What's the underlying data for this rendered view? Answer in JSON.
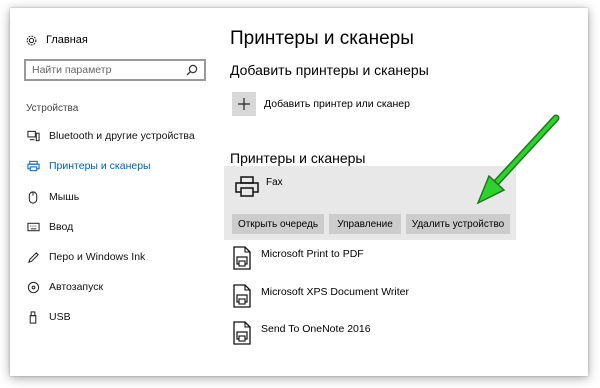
{
  "sidebar": {
    "home_label": "Главная",
    "search_placeholder": "Найти параметр",
    "section_label": "Устройства",
    "items": [
      {
        "label": "Bluetooth и другие устройства",
        "icon": "bluetooth-devices-icon"
      },
      {
        "label": "Принтеры и сканеры",
        "icon": "printer-icon",
        "active": true
      },
      {
        "label": "Мышь",
        "icon": "mouse-icon"
      },
      {
        "label": "Ввод",
        "icon": "keyboard-icon"
      },
      {
        "label": "Перо и Windows Ink",
        "icon": "pen-icon"
      },
      {
        "label": "Автозапуск",
        "icon": "autoplay-icon"
      },
      {
        "label": "USB",
        "icon": "usb-icon"
      }
    ]
  },
  "main": {
    "title": "Принтеры и сканеры",
    "add_section_title": "Добавить принтеры и сканеры",
    "add_button_label": "Добавить принтер или сканер",
    "list_section_title": "Принтеры и сканеры",
    "selected_device": {
      "name": "Fax",
      "buttons": [
        "Открыть очередь",
        "Управление",
        "Удалить устройство"
      ]
    },
    "devices": [
      "Microsoft Print to PDF",
      "Microsoft XPS Document Writer",
      "Send To OneNote 2016"
    ]
  },
  "colors": {
    "accent": "#0063b1",
    "annotation_arrow": "#22b822"
  }
}
